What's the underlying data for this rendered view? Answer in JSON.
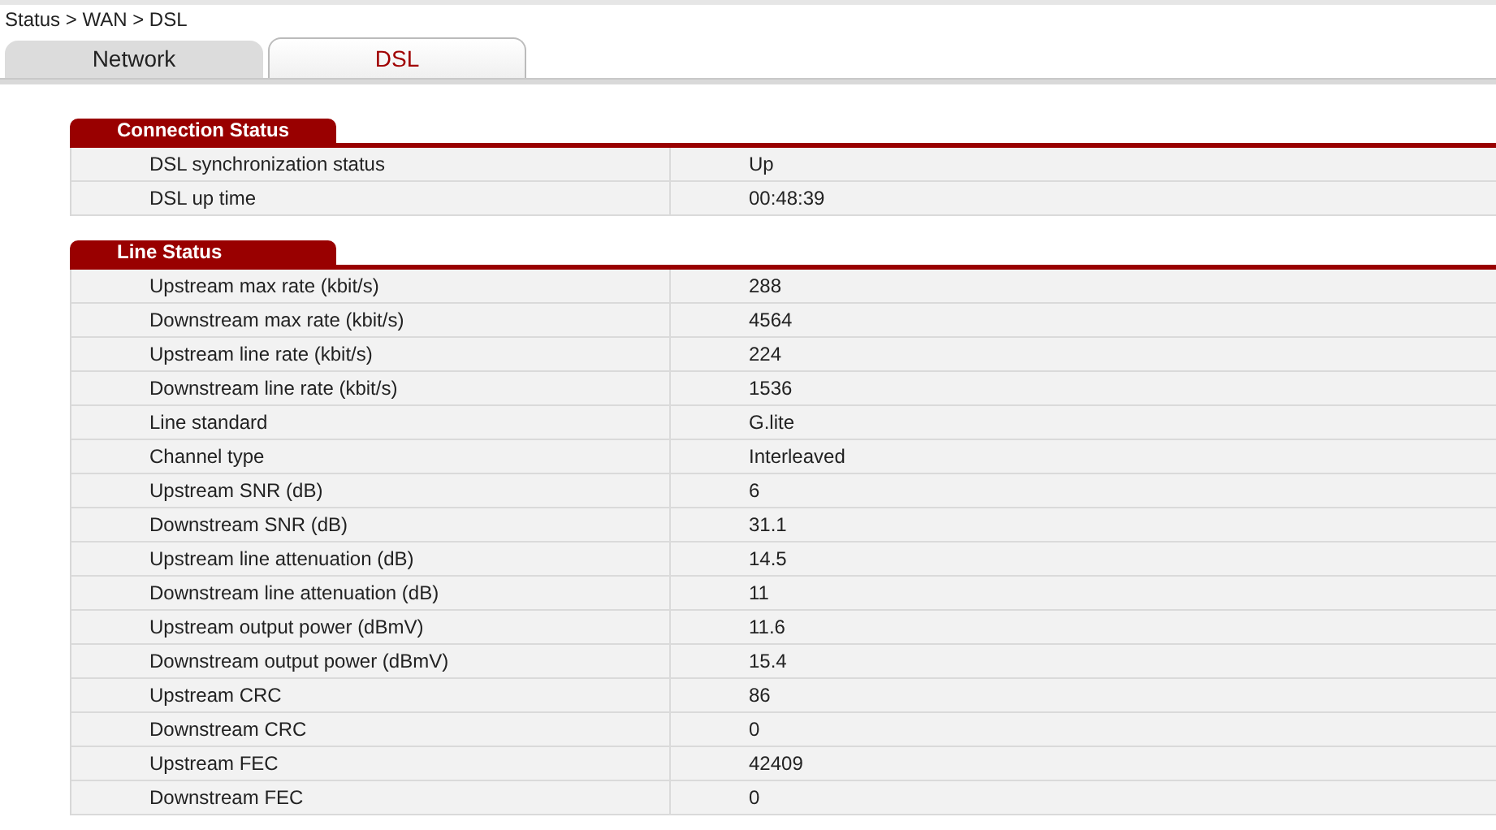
{
  "breadcrumb": "Status > WAN > DSL",
  "tabs": [
    {
      "label": "Network",
      "selected": false
    },
    {
      "label": "DSL",
      "selected": true
    }
  ],
  "sections": [
    {
      "title": "Connection Status",
      "rows": [
        {
          "label": "DSL synchronization status",
          "value": "Up"
        },
        {
          "label": "DSL up time",
          "value": "00:48:39"
        }
      ]
    },
    {
      "title": "Line Status",
      "rows": [
        {
          "label": "Upstream max rate (kbit/s)",
          "value": "288"
        },
        {
          "label": "Downstream max rate (kbit/s)",
          "value": "4564"
        },
        {
          "label": "Upstream line rate (kbit/s)",
          "value": "224"
        },
        {
          "label": "Downstream line rate (kbit/s)",
          "value": "1536"
        },
        {
          "label": "Line standard",
          "value": "G.lite"
        },
        {
          "label": "Channel type",
          "value": "Interleaved"
        },
        {
          "label": "Upstream SNR (dB)",
          "value": "6"
        },
        {
          "label": "Downstream SNR (dB)",
          "value": "31.1"
        },
        {
          "label": "Upstream line attenuation (dB)",
          "value": "14.5"
        },
        {
          "label": "Downstream line attenuation (dB)",
          "value": "11"
        },
        {
          "label": "Upstream output power (dBmV)",
          "value": "11.6"
        },
        {
          "label": "Downstream output power (dBmV)",
          "value": "15.4"
        },
        {
          "label": "Upstream CRC",
          "value": "86"
        },
        {
          "label": "Downstream CRC",
          "value": "0"
        },
        {
          "label": "Upstream FEC",
          "value": "42409"
        },
        {
          "label": "Downstream FEC",
          "value": "0"
        }
      ]
    }
  ]
}
